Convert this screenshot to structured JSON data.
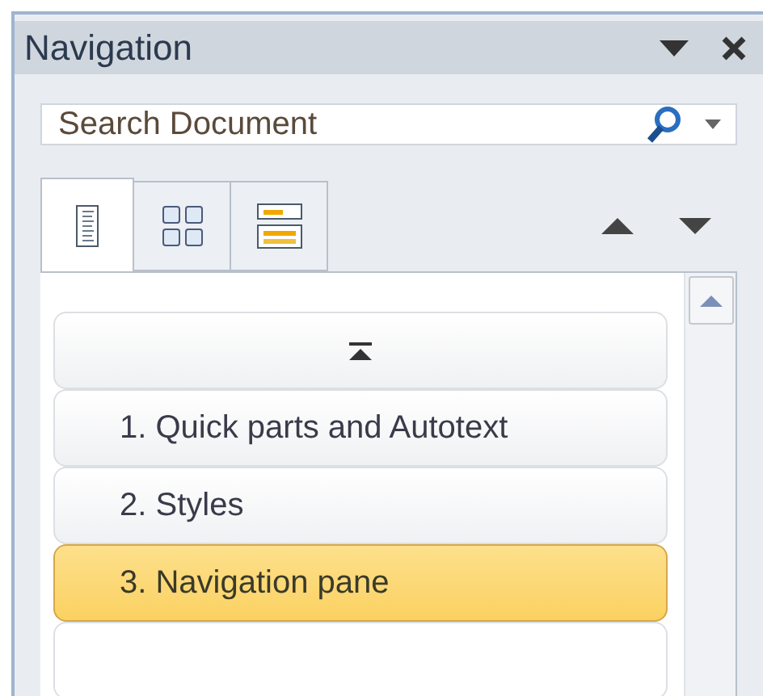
{
  "title": "Navigation",
  "search": {
    "placeholder": "Search Document"
  },
  "tabs": [
    {
      "kind": "headings",
      "selected": true
    },
    {
      "kind": "pages",
      "selected": false
    },
    {
      "kind": "results",
      "selected": false
    }
  ],
  "headings": [
    {
      "label": "1. Quick parts and Autotext",
      "selected": false
    },
    {
      "label": "2. Styles",
      "selected": false
    },
    {
      "label": "3. Navigation pane",
      "selected": true
    }
  ]
}
